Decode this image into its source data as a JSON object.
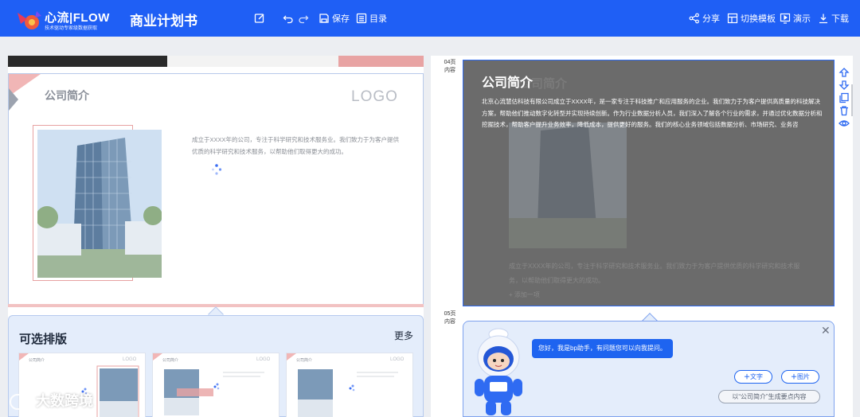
{
  "header": {
    "logo_main": "心流|FLOW",
    "logo_sub": "技术驱动专家级数据获取",
    "title": "商业计划书",
    "undo_tooltip": "",
    "save_label": "保存",
    "toc_label": "目录",
    "share_label": "分享",
    "template_label": "切换模板",
    "present_label": "演示",
    "download_label": "下载"
  },
  "left_slide": {
    "heading": "公司简介",
    "logo_text": "LOGO",
    "body": "成立于XXXX年的公司，专注于科学研究和技术服务业。我们致力于为客户提供优质的科学研究和技术服务，以帮助他们取得更大的成功。"
  },
  "layouts": {
    "title": "可选排版",
    "more": "更多",
    "thumbs": [
      {
        "heading": "公司简介",
        "logo": "LOGO"
      },
      {
        "heading": "公司简介",
        "logo": "LOGO"
      },
      {
        "heading": "公司简介",
        "logo": "LOGO"
      }
    ]
  },
  "right_panel": {
    "page4_num": "04页",
    "page4_kind": "内容",
    "page5_num": "05页",
    "page5_kind": "内容",
    "slide_title": "公司简介",
    "slide_body": "北京心流慧估科技有限公司成立于XXXX年，是一家专注于科技推广和应用服务的企业。我们致力于为客户提供高质量的科技解决方案，帮助他们推动数字化转型并实现持续创新。作为行业数据分析人员，我们深入了解各个行业的需求，并通过优化数据分析和挖掘技术，帮助客户提升业务效率，降低成本，提供更好的服务。我们的核心业务领域包括数据分析、市场研究、业务咨",
    "ghost_heading": "公司简介",
    "ghost_body": "成立于XXXX年的公司，专注于科学研究和技术服务业。我们致力于为客户提供优质的科学研究和技术服务，以帮助他们取得更大的成功。",
    "ghost_add": "+ 添加一项"
  },
  "assistant": {
    "greeting": "您好，我是bp助手，有问题您可以向我提问。",
    "text_btn": "文字",
    "image_btn": "图片",
    "suggest_btn": "以“公司简介”生成要点内容"
  },
  "watermark": "大数跨境",
  "colors": {
    "header_bg": "#1f5ff5",
    "accent": "#1e64f0",
    "slide_pink": "#e8a3a3"
  }
}
